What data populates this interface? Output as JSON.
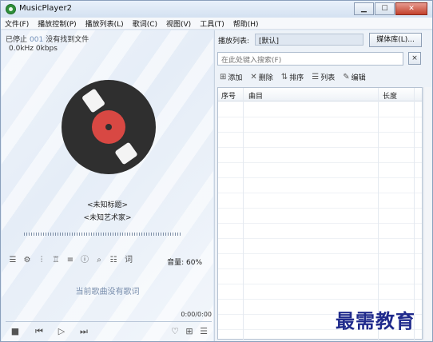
{
  "window": {
    "title": "MusicPlayer2",
    "min": "▁",
    "max": "☐",
    "close": "✕"
  },
  "menu": [
    "文件(F)",
    "播放控制(P)",
    "播放列表(L)",
    "歌词(C)",
    "视图(V)",
    "工具(T)",
    "帮助(H)"
  ],
  "player": {
    "status": "已停止",
    "index": "001",
    "message": "没有找到文件",
    "format": "0.0kHz 0kbps",
    "title": "<未知标题>",
    "artist": "<未知艺术家>",
    "volume": "音量: 60%",
    "lyrics_text": "词",
    "no_lyrics": "当前歌曲没有歌词",
    "time": "0:00/0:00",
    "volume_percent": 60,
    "progress_fraction": 0
  },
  "playlist": {
    "label": "播放列表:",
    "name": "[默认]",
    "media_button": "媒体库(L)...",
    "search_placeholder": "在此处键入搜索(F)",
    "clear": "×",
    "tools": {
      "add": "添加",
      "delete": "删除",
      "sort": "排序",
      "list": "列表",
      "edit": "编辑"
    },
    "columns": [
      "序号",
      "曲目",
      "长度"
    ]
  },
  "icons": {
    "stop": "stop-icon",
    "prev": "previous-icon",
    "play": "play-icon",
    "next": "next-icon",
    "favorite": "heart-icon",
    "grid": "grid-icon",
    "playlist": "playlist-icon"
  },
  "watermark": "最需教育"
}
